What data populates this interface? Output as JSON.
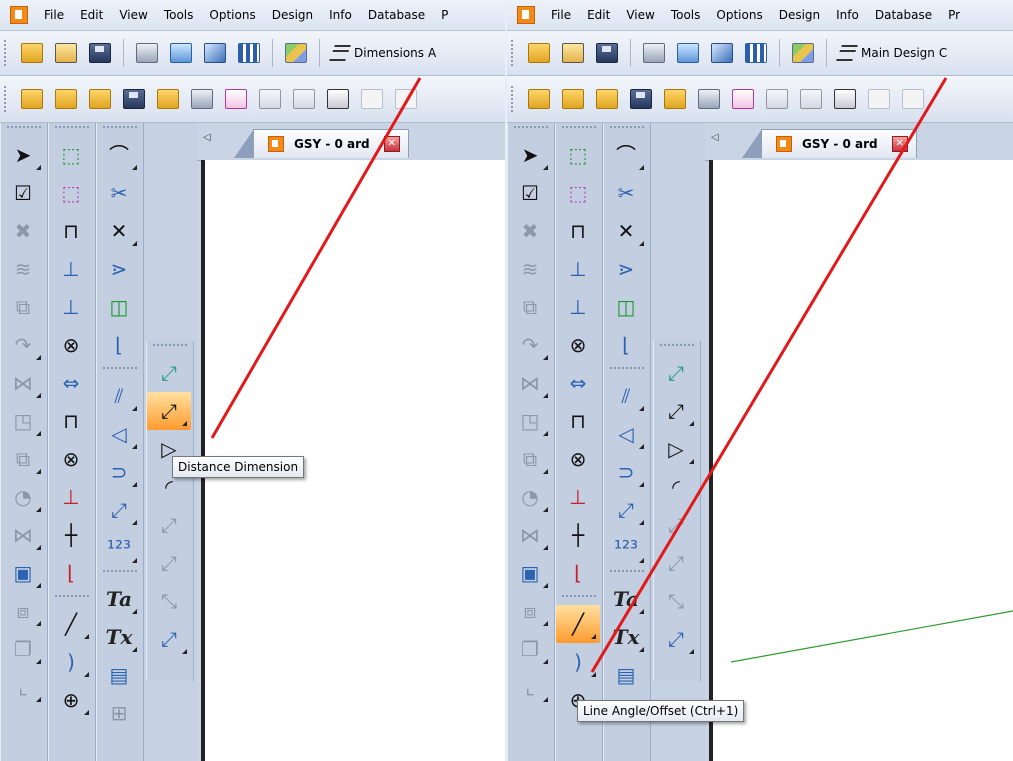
{
  "menu": [
    "File",
    "Edit",
    "View",
    "Tools",
    "Options",
    "Design",
    "Info",
    "Database",
    "P"
  ],
  "menu_right": [
    "File",
    "Edit",
    "View",
    "Tools",
    "Options",
    "Design",
    "Info",
    "Database",
    "Pr"
  ],
  "left": {
    "layer_label": "Dimensions",
    "layer_clip": "A",
    "doc_tab": "GSY - 0 ard",
    "tooltip": "Distance Dimension"
  },
  "right": {
    "layer_label": "Main Design",
    "layer_clip": "C",
    "doc_tab": "GSY - 0 ard",
    "tooltip": "Line Angle/Offset (Ctrl+1)"
  },
  "tab_scroll_glyph": "◁",
  "tab_close_glyph": "✕",
  "text_tools": [
    "Ta",
    "Tx"
  ],
  "colors": {
    "annotation_line": "#e01a1a",
    "canvas_line": "#2f9a2f",
    "active_tool": "#ff9a2e",
    "app_icon": "#f08a1a"
  }
}
